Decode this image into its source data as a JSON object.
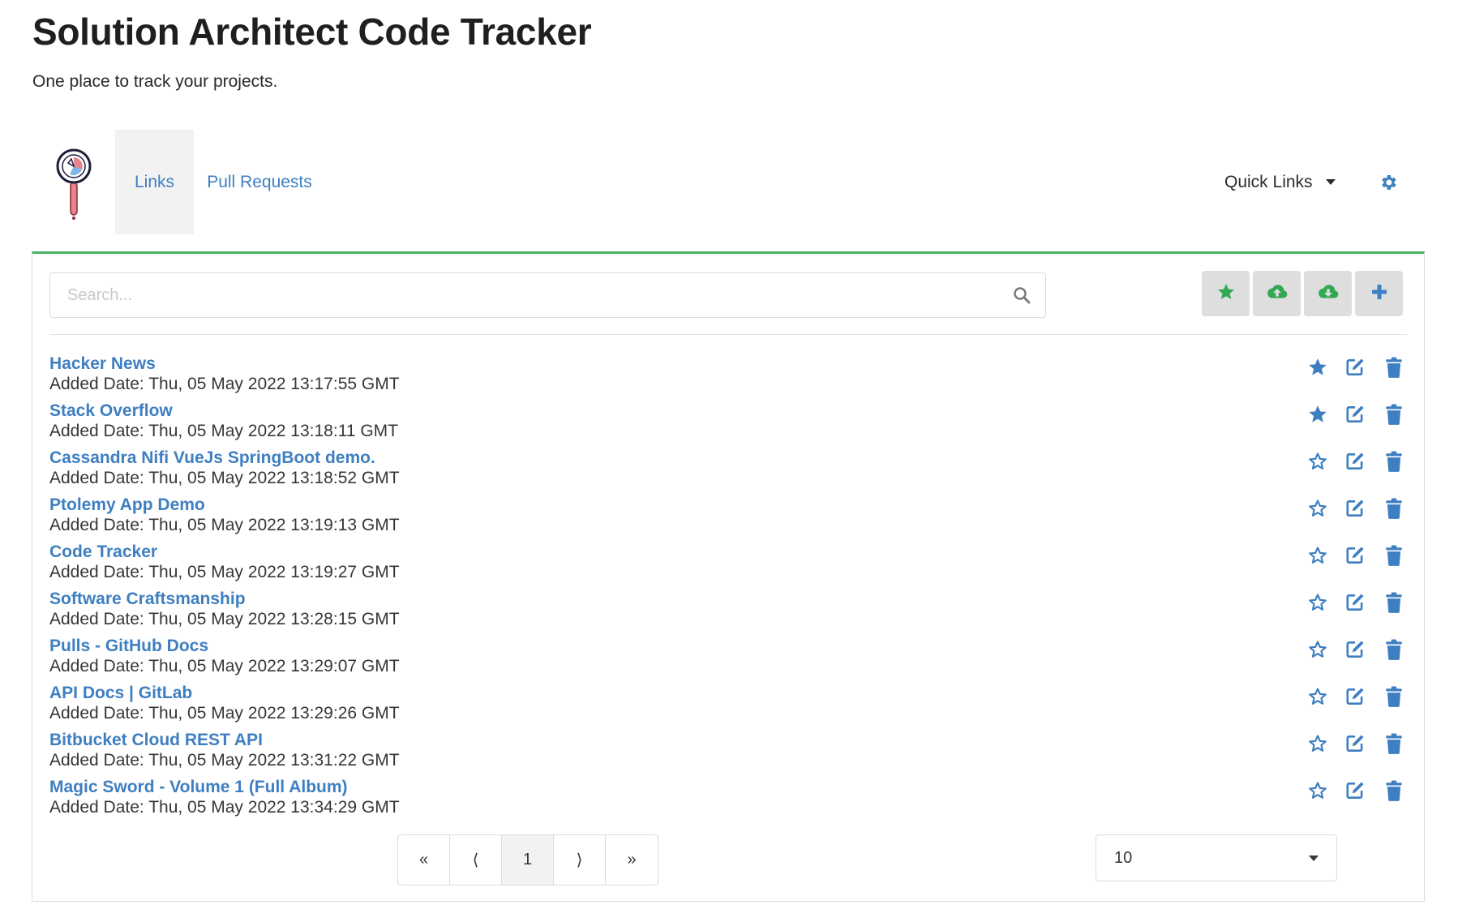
{
  "header": {
    "title": "Solution Architect Code Tracker",
    "subtitle": "One place to track your projects."
  },
  "nav": {
    "logo_icon": "magnifier-chart-icon",
    "tabs": [
      {
        "label": "Links",
        "active": true
      },
      {
        "label": "Pull Requests",
        "active": false
      }
    ],
    "quick_links_label": "Quick Links",
    "settings_icon": "gear-icon"
  },
  "toolbar": {
    "search_placeholder": "Search...",
    "search_icon": "search-icon",
    "buttons": [
      {
        "icon": "star-icon"
      },
      {
        "icon": "cloud-upload-icon"
      },
      {
        "icon": "cloud-download-icon"
      },
      {
        "icon": "plus-icon"
      }
    ]
  },
  "links": [
    {
      "name": "Hacker News",
      "date": "Added Date: Thu, 05 May 2022 13:17:55 GMT",
      "starred": true
    },
    {
      "name": "Stack Overflow",
      "date": "Added Date: Thu, 05 May 2022 13:18:11 GMT",
      "starred": true
    },
    {
      "name": "Cassandra Nifi VueJs SpringBoot demo.",
      "date": "Added Date: Thu, 05 May 2022 13:18:52 GMT",
      "starred": false
    },
    {
      "name": "Ptolemy App Demo",
      "date": "Added Date: Thu, 05 May 2022 13:19:13 GMT",
      "starred": false
    },
    {
      "name": "Code Tracker",
      "date": "Added Date: Thu, 05 May 2022 13:19:27 GMT",
      "starred": false
    },
    {
      "name": "Software Craftsmanship",
      "date": "Added Date: Thu, 05 May 2022 13:28:15 GMT",
      "starred": false
    },
    {
      "name": "Pulls - GitHub Docs",
      "date": "Added Date: Thu, 05 May 2022 13:29:07 GMT",
      "starred": false
    },
    {
      "name": "API Docs | GitLab",
      "date": "Added Date: Thu, 05 May 2022 13:29:26 GMT",
      "starred": false
    },
    {
      "name": "Bitbucket Cloud REST API",
      "date": "Added Date: Thu, 05 May 2022 13:31:22 GMT",
      "starred": false
    },
    {
      "name": "Magic Sword - Volume 1 (Full Album)",
      "date": "Added Date: Thu, 05 May 2022 13:34:29 GMT",
      "starred": false
    }
  ],
  "pagination": {
    "first": "«",
    "prev": "⟨",
    "current": "1",
    "next": "⟩",
    "last": "»"
  },
  "per_page": "10",
  "colors": {
    "link": "#3e7fc1",
    "accent_green": "#48b461",
    "button_bg": "#dedede"
  }
}
